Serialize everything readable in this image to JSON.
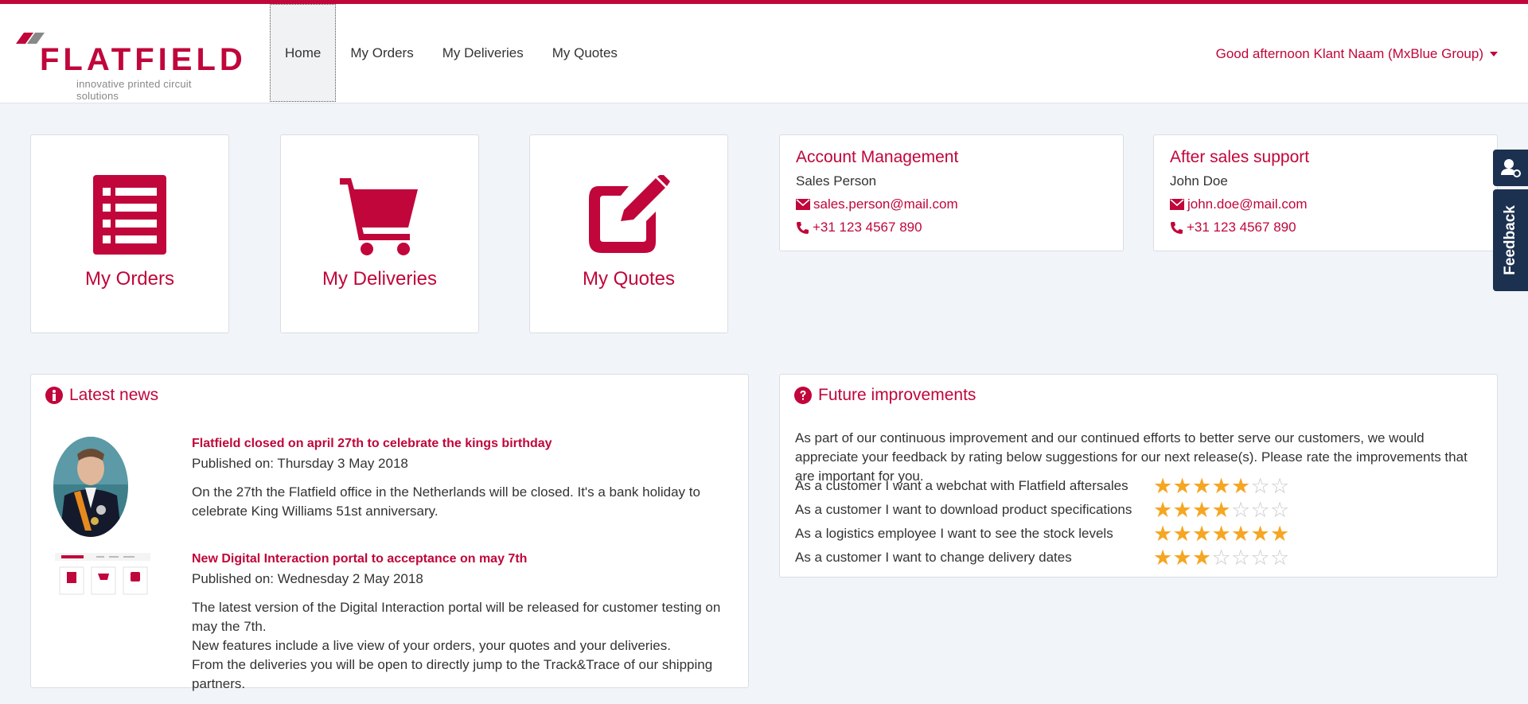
{
  "header": {
    "logo_word": "FLATFIELD",
    "logo_tagline": "innovative printed circuit solutions",
    "nav": [
      "Home",
      "My Orders",
      "My Deliveries",
      "My Quotes"
    ],
    "active_nav": "Home",
    "greeting": "Good afternoon Klant Naam (MxBlue Group)"
  },
  "tiles": [
    {
      "label": "My Orders",
      "icon": "list-icon"
    },
    {
      "label": "My Deliveries",
      "icon": "cart-icon"
    },
    {
      "label": "My Quotes",
      "icon": "edit-icon"
    }
  ],
  "account": {
    "title": "Account Management",
    "name": "Sales Person",
    "email": "sales.person@mail.com",
    "phone": "+31 123 4567 890"
  },
  "support": {
    "title": "After sales support",
    "name": "John Doe",
    "email": "john.doe@mail.com",
    "phone": "+31 123 4567 890"
  },
  "news": {
    "title": "Latest news",
    "items": [
      {
        "title": "Flatfield closed on april 27th to celebrate the kings birthday",
        "date": "Published on: Thursday 3 May 2018",
        "body": [
          "On the 27th the Flatfield office in the Netherlands will be closed. It's a bank holiday to celebrate King Williams 51st anniversary."
        ]
      },
      {
        "title": "New Digital Interaction portal to acceptance on may 7th",
        "date": "Published on: Wednesday 2 May 2018",
        "body": [
          "The latest version of the Digital Interaction portal will be released for customer testing on may the 7th.",
          "New features include a live view of your orders, your quotes and your deliveries.",
          "From the deliveries you will be open to directly jump to the Track&Trace of our shipping partners."
        ]
      }
    ]
  },
  "future": {
    "title": "Future improvements",
    "intro": "As part of our continuous improvement and our continued efforts to better serve our customers, we would appreciate your feedback by rating below suggestions for our next release(s). Please rate the improvements that are important for you.",
    "items": [
      {
        "label": "As a customer I want a webchat with Flatfield aftersales",
        "rating": 5,
        "max": 7
      },
      {
        "label": "As a customer I want to download product specifications",
        "rating": 4,
        "max": 7
      },
      {
        "label": "As a logistics employee I want to see the stock levels",
        "rating": 7,
        "max": 7
      },
      {
        "label": "As a customer I want to change delivery dates",
        "rating": 3,
        "max": 7
      }
    ]
  },
  "sidebar": {
    "feedback_label": "Feedback",
    "user_icon": "user-settings-icon"
  },
  "colors": {
    "brand": "#c0063a",
    "star": "#f5a623",
    "side_tab": "#1c3150"
  }
}
